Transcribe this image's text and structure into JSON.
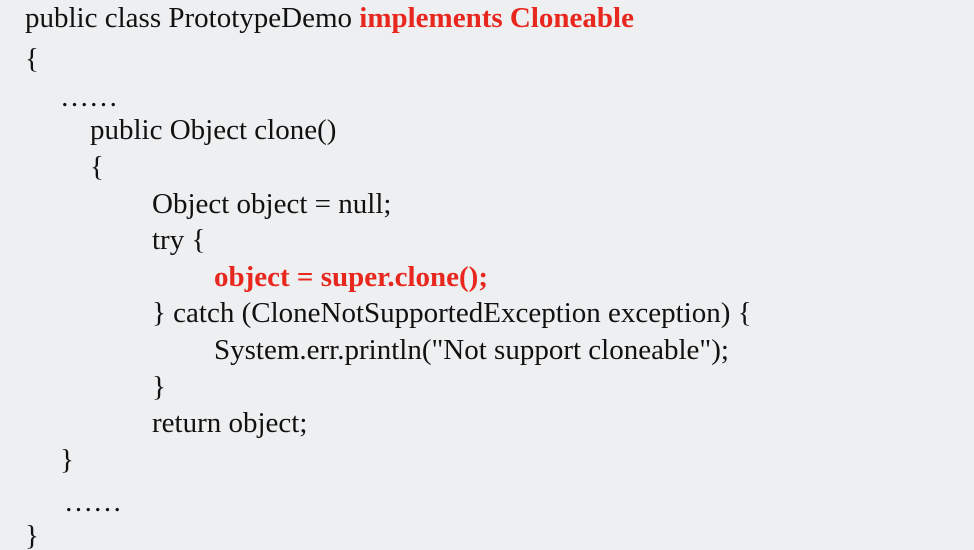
{
  "colors": {
    "background": "#eeeff0",
    "text": "#111111",
    "highlight": "#e8271e"
  },
  "code": {
    "line1_prefix": "public class PrototypeDemo ",
    "line1_highlight": "implements Cloneable",
    "open_brace_class": "{",
    "ellipsis_top": "……",
    "method_signature": "public Object clone()",
    "open_brace_method": "{",
    "declaration": "Object object = null;",
    "try_open": "try {",
    "clone_call": "object = super.clone();",
    "catch_clause": "} catch (CloneNotSupportedException exception) {",
    "print_error": "System.err.println(\"Not support cloneable\");",
    "close_brace_catch": "}",
    "return_statement": "return object;",
    "close_brace_method": "}",
    "ellipsis_bottom": "……",
    "close_brace_class": "}"
  }
}
